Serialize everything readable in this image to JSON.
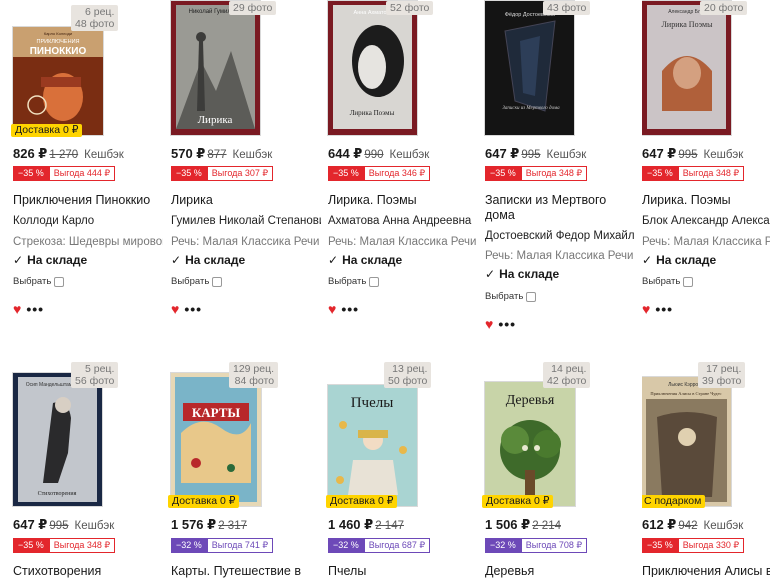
{
  "common": {
    "cashback": "Кешбэк",
    "in_stock": "На складе",
    "choose": "Выбрать",
    "shipping": "Доставка 0 ₽",
    "gift": "С подарком",
    "heart_icon": "heart-icon",
    "more_icon": "more-dots-icon",
    "check_icon": "check-icon"
  },
  "colors": {
    "discount_red": "#e3262c",
    "discount_purple": "#6d49b8",
    "shipping_yellow": "#ffd400",
    "badge_bg": "#e8e4df"
  },
  "products": [
    {
      "reviews": "6 рец.",
      "photos": "48 фото",
      "price": "826 ₽",
      "old": "1 270",
      "discount": "−35 %",
      "gain": "Выгода 444 ₽",
      "disc_color": "red",
      "title": "Приключения Пиноккио",
      "title2": "",
      "author": "Коллоди Карло",
      "series": "Стрекоза: Шедевры мировой л",
      "cover_label": "ПИНОККИО",
      "cover_top": "ПРИКЛЮЧЕНИЯ",
      "ship": "shipping"
    },
    {
      "reviews": "",
      "photos": "29 фото",
      "price": "570 ₽",
      "old": "877",
      "discount": "−35 %",
      "gain": "Выгода 307 ₽",
      "disc_color": "red",
      "title": "Лирика",
      "title2": "",
      "author": "Гумилев Николай Степанович",
      "series": "Речь: Малая Классика Речи",
      "cover_label": "Лирика",
      "cover_top": "Николай Гумилёв",
      "ship": ""
    },
    {
      "reviews": "",
      "photos": "52 фото",
      "price": "644 ₽",
      "old": "990",
      "discount": "−35 %",
      "gain": "Выгода 346 ₽",
      "disc_color": "red",
      "title": "Лирика. Поэмы",
      "title2": "",
      "author": "Ахматова Анна Андреевна",
      "series": "Речь: Малая Классика Речи",
      "cover_label": "Лирика\nПоэмы",
      "cover_top": "Анна Ахматова",
      "ship": ""
    },
    {
      "reviews": "",
      "photos": "43 фото",
      "price": "647 ₽",
      "old": "995",
      "discount": "−35 %",
      "gain": "Выгода 348 ₽",
      "disc_color": "red",
      "title": "Записки из Мертвого",
      "title2": "дома",
      "author": "Достоевский Федор Михайлов",
      "series": "Речь: Малая Классика Речи",
      "cover_label": "Записки из Мертвого дома",
      "cover_top": "Фёдор Достоевский",
      "ship": ""
    },
    {
      "reviews": "",
      "photos": "20 фото",
      "price": "647 ₽",
      "old": "995",
      "discount": "−35 %",
      "gain": "Выгода 348 ₽",
      "disc_color": "red",
      "title": "Лирика. Поэмы",
      "title2": "",
      "author": "Блок Александр Александр",
      "series": "Речь: Малая Классика Речи",
      "cover_label": "Лирика\nПоэмы",
      "cover_top": "Александр Блок",
      "ship": ""
    },
    {
      "reviews": "5 рец.",
      "photos": "56 фото",
      "price": "647 ₽",
      "old": "995",
      "discount": "−35 %",
      "gain": "Выгода 348 ₽",
      "disc_color": "red",
      "title": "Стихотворения",
      "title2": "",
      "author": "",
      "series": "",
      "cover_label": "Стихотворения",
      "cover_top": "Осип Мандельштам",
      "ship": ""
    },
    {
      "reviews": "129 рец.",
      "photos": "84 фото",
      "price": "1 576 ₽",
      "old": "2 317",
      "discount": "−32 %",
      "gain": "Выгода 741 ₽",
      "disc_color": "purple",
      "title": "Карты. Путешествие в",
      "title2": "",
      "author": "",
      "series": "",
      "cover_label": "КАРТЫ",
      "cover_top": "",
      "ship": "shipping"
    },
    {
      "reviews": "13 рец.",
      "photos": "50 фото",
      "price": "1 460 ₽",
      "old": "2 147",
      "discount": "−32 %",
      "gain": "Выгода 687 ₽",
      "disc_color": "purple",
      "title": "Пчелы",
      "title2": "",
      "author": "",
      "series": "",
      "cover_label": "Пчелы",
      "cover_top": "",
      "ship": "shipping"
    },
    {
      "reviews": "14 рец.",
      "photos": "42 фото",
      "price": "1 506 ₽",
      "old": "2 214",
      "discount": "−32 %",
      "gain": "Выгода 708 ₽",
      "disc_color": "purple",
      "title": "Деревья",
      "title2": "",
      "author": "",
      "series": "",
      "cover_label": "Деревья",
      "cover_top": "",
      "ship": "shipping"
    },
    {
      "reviews": "17 рец.",
      "photos": "39 фото",
      "price": "612 ₽",
      "old": "942",
      "discount": "−35 %",
      "gain": "Выгода 330 ₽",
      "disc_color": "red",
      "title": "Приключения Алисы в",
      "title2": "",
      "author": "",
      "series": "",
      "cover_label": "Приключения Алисы в Стране Чудес",
      "cover_top": "Льюис Кэрролл",
      "ship": "gift"
    }
  ]
}
